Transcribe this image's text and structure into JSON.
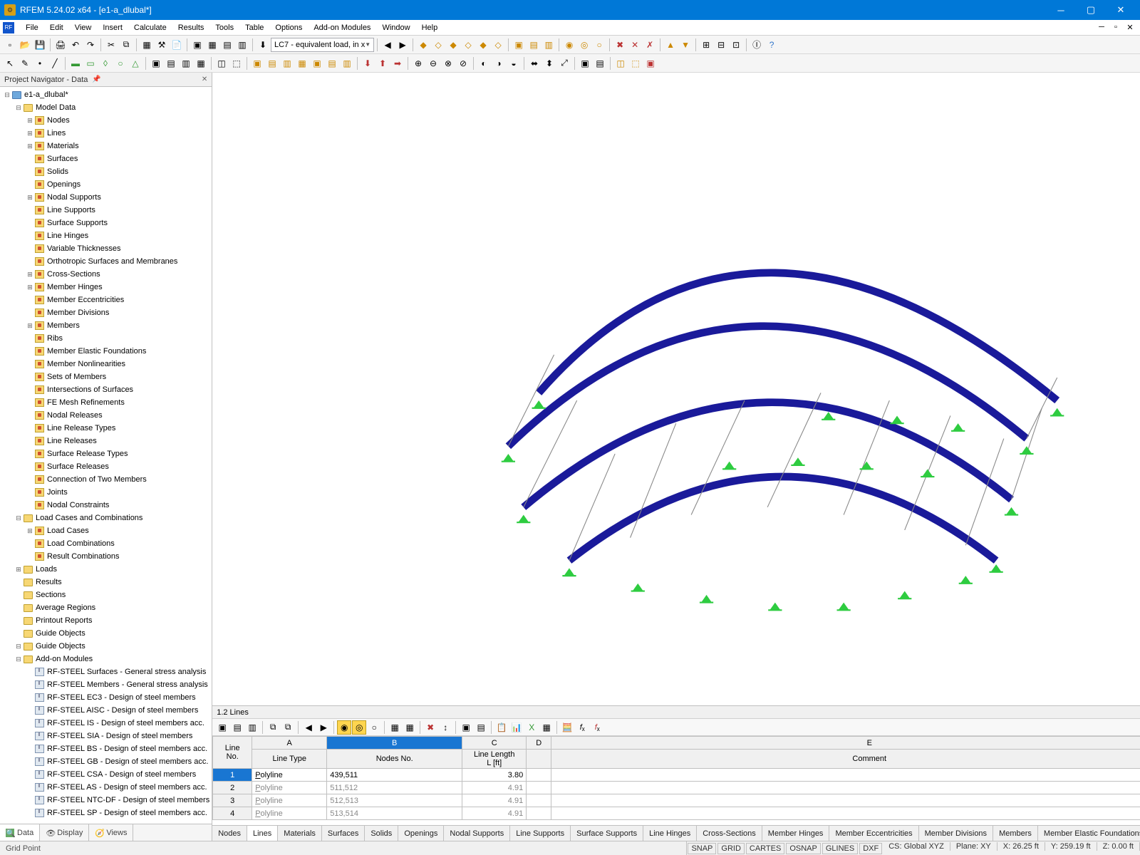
{
  "window": {
    "title": "RFEM 5.24.02 x64 - [e1-a_dlubal*]"
  },
  "menu": [
    "File",
    "Edit",
    "View",
    "Insert",
    "Calculate",
    "Results",
    "Tools",
    "Table",
    "Options",
    "Add-on Modules",
    "Window",
    "Help"
  ],
  "loadcase_combo": "LC7 - equivalent load, in x",
  "navigator": {
    "title": "Project Navigator - Data",
    "root": "e1-a_dlubal*",
    "model_data": "Model Data",
    "model_children": [
      "Nodes",
      "Lines",
      "Materials",
      "Surfaces",
      "Solids",
      "Openings",
      "Nodal Supports",
      "Line Supports",
      "Surface Supports",
      "Line Hinges",
      "Variable Thicknesses",
      "Orthotropic Surfaces and Membranes",
      "Cross-Sections",
      "Member Hinges",
      "Member Eccentricities",
      "Member Divisions",
      "Members",
      "Ribs",
      "Member Elastic Foundations",
      "Member Nonlinearities",
      "Sets of Members",
      "Intersections of Surfaces",
      "FE Mesh Refinements",
      "Nodal Releases",
      "Line Release Types",
      "Line Releases",
      "Surface Release Types",
      "Surface Releases",
      "Connection of Two Members",
      "Joints",
      "Nodal Constraints"
    ],
    "load_cases_section": "Load Cases and Combinations",
    "load_cases_children": [
      "Load Cases",
      "Load Combinations",
      "Result Combinations"
    ],
    "more_sections": [
      "Loads",
      "Results",
      "Sections",
      "Average Regions",
      "Printout Reports",
      "Guide Objects"
    ],
    "addon": "Add-on Modules",
    "addon_children": [
      "RF-STEEL Surfaces - General stress analysis",
      "RF-STEEL Members - General stress analysis",
      "RF-STEEL EC3 - Design of steel members",
      "RF-STEEL AISC - Design of steel members",
      "RF-STEEL IS - Design of steel members acc.",
      "RF-STEEL SIA - Design of steel members",
      "RF-STEEL BS - Design of steel members acc.",
      "RF-STEEL GB - Design of steel members acc.",
      "RF-STEEL CSA - Design of steel members",
      "RF-STEEL AS - Design of steel members acc.",
      "RF-STEEL NTC-DF - Design of steel members",
      "RF-STEEL SP - Design of steel members acc."
    ],
    "tabs": [
      "Data",
      "Display",
      "Views"
    ]
  },
  "table": {
    "title": "1.2 Lines",
    "cols": [
      "A",
      "B",
      "C",
      "D",
      "E"
    ],
    "rowhead": [
      "Line No.",
      "Line Type",
      "Nodes No.",
      "Line Length L [ft]",
      "",
      "Comment"
    ],
    "h1_line": "Line",
    "h1_no": "No.",
    "h_linetype": "Line Type",
    "h_nodes": "Nodes No.",
    "h_len1": "Line Length",
    "h_len2": "L [ft]",
    "h_comment": "Comment",
    "rows": [
      {
        "n": "1",
        "type": "Polyline",
        "nodes": "439,511",
        "len": "3.80"
      },
      {
        "n": "2",
        "type": "Polyline",
        "nodes": "511,512",
        "len": "4.91"
      },
      {
        "n": "3",
        "type": "Polyline",
        "nodes": "512,513",
        "len": "4.91"
      },
      {
        "n": "4",
        "type": "Polyline",
        "nodes": "513,514",
        "len": "4.91"
      }
    ],
    "tabs": [
      "Nodes",
      "Lines",
      "Materials",
      "Surfaces",
      "Solids",
      "Openings",
      "Nodal Supports",
      "Line Supports",
      "Surface Supports",
      "Line Hinges",
      "Cross-Sections",
      "Member Hinges",
      "Member Eccentricities",
      "Member Divisions",
      "Members",
      "Member Elastic Foundations"
    ]
  },
  "status": {
    "left": "Grid Point",
    "toggles": [
      "SNAP",
      "GRID",
      "CARTES",
      "OSNAP",
      "GLINES",
      "DXF"
    ],
    "cs": "CS: Global XYZ",
    "plane": "Plane: XY",
    "x": "X: 26.25 ft",
    "y": "Y: 259.19 ft",
    "z": "Z: 0.00 ft"
  }
}
